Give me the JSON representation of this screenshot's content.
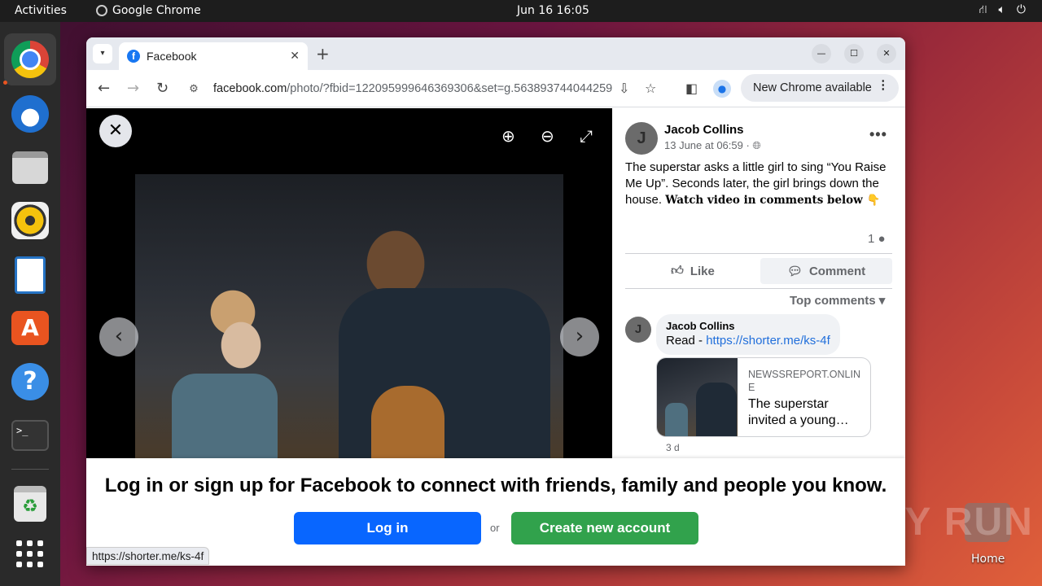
{
  "topbar": {
    "activities": "Activities",
    "app_name": "Google Chrome",
    "clock": "Jun 16  16:05",
    "tray_icons": [
      "network-icon",
      "volume-icon",
      "power-icon"
    ]
  },
  "dock": {
    "items": [
      "chrome",
      "thunderbird",
      "files",
      "rhythmbox",
      "libreoffice-writer",
      "app-center",
      "help",
      "terminal",
      "trash",
      "show-apps"
    ]
  },
  "desktop": {
    "home_label": "Home",
    "watermark": "ANY RUN"
  },
  "browser": {
    "tab_title": "Facebook",
    "url_host": "facebook.com",
    "url_path": "/photo/?fbid=122095999646369306&set=g.563893744044259",
    "update_label": "New Chrome available",
    "status_url": "https://shorter.me/ks-4f"
  },
  "post": {
    "avatar_initial": "J",
    "author": "Jacob Collins",
    "meta": "13 June at 06:59 · ",
    "text": "The superstar asks a little girl to sing “You Raise Me Up”. Seconds later, the girl brings down the house. ",
    "text_bold": "Watch video in comments below 👇",
    "comment_count": "1",
    "like_label": "Like",
    "comment_label": "Comment",
    "top_comments": "Top comments ▾"
  },
  "comment": {
    "avatar_initial": "J",
    "author": "Jacob Collins",
    "prefix": "Read - ",
    "link": "https://shorter.me/ks-4f",
    "card_source": "NEWSSREPORT.ONLINE",
    "card_title": "The superstar invited a young…",
    "time": "3 d"
  },
  "login_prompt": {
    "title": "Log in or sign up for Facebook to connect with friends, family and people you know.",
    "login_label": "Log in",
    "or_label": "or",
    "create_label": "Create new account"
  },
  "colors": {
    "facebook_blue": "#0866ff",
    "create_green": "#31a24c",
    "link_blue": "#216fdb"
  }
}
